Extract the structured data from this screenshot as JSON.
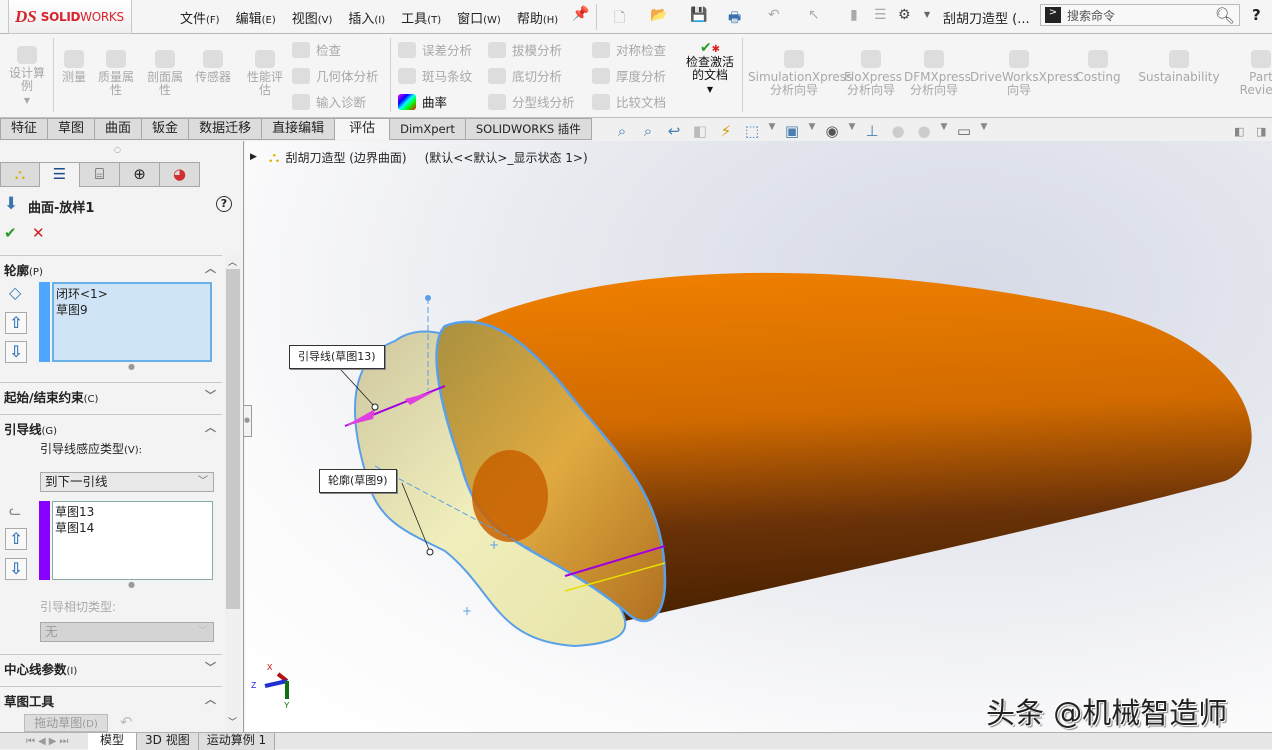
{
  "app": {
    "logo_ds": "DS",
    "logo_solid": "SOLID",
    "logo_works": "WORKS",
    "doc_title": "刮胡刀造型 (..."
  },
  "menu": [
    {
      "label": "文件",
      "key": "(F)"
    },
    {
      "label": "编辑",
      "key": "(E)"
    },
    {
      "label": "视图",
      "key": "(V)"
    },
    {
      "label": "插入",
      "key": "(I)"
    },
    {
      "label": "工具",
      "key": "(T)"
    },
    {
      "label": "窗口",
      "key": "(W)"
    },
    {
      "label": "帮助",
      "key": "(H)"
    }
  ],
  "quick_access": [
    "new-icon",
    "open-icon",
    "save-icon",
    "print-icon",
    "undo-icon",
    "select-icon",
    "rebuild-icon",
    "file-properties-icon",
    "options-icon"
  ],
  "search": {
    "placeholder": "搜索命令",
    "help": "?"
  },
  "ribbon": {
    "design_study": "设计算例",
    "big_buttons": [
      "测量",
      "质量属性",
      "剖面属性",
      "传感器",
      "性能评估"
    ],
    "col1": [
      "检查",
      "几何体分析",
      "输入诊断"
    ],
    "col2": [
      "误差分析",
      "斑马条纹",
      "曲率"
    ],
    "col3": [
      "拔模分析",
      "底切分析",
      "分型线分析"
    ],
    "col4": [
      "对称检查",
      "厚度分析",
      "比较文档"
    ],
    "check_active": "检查激活的文档",
    "addins": [
      {
        "line1": "SimulationXpress",
        "line2": "分析向导"
      },
      {
        "line1": "FloXpress",
        "line2": "分析向导"
      },
      {
        "line1": "DFMXpress",
        "line2": "分析向导"
      },
      {
        "line1": "DriveWorksXpress",
        "line2": "向导"
      },
      {
        "line1": "Costing",
        "line2": ""
      },
      {
        "line1": "Sustainability",
        "line2": ""
      },
      {
        "line1": "Part",
        "line2": "Review"
      }
    ]
  },
  "tabs": [
    {
      "label": "特征",
      "active": false
    },
    {
      "label": "草图",
      "active": false
    },
    {
      "label": "曲面",
      "active": false
    },
    {
      "label": "钣金",
      "active": false
    },
    {
      "label": "数据迁移",
      "active": false
    },
    {
      "label": "直接编辑",
      "active": false
    },
    {
      "label": "评估",
      "active": true
    },
    {
      "label": "DimXpert",
      "active": false
    },
    {
      "label": "SOLIDWORKS 插件",
      "active": false
    }
  ],
  "panel": {
    "feature_title": "曲面-放样1",
    "sections": {
      "profile": {
        "title": "轮廓",
        "key": "(P)",
        "items": [
          "闭环<1>",
          "草图9"
        ],
        "color": "#4da6ff"
      },
      "start_end": {
        "title": "起始/结束约束",
        "key": "(C)"
      },
      "guides": {
        "title": "引导线",
        "key": "(G)",
        "influence_label": "引导线感应类型",
        "influence_key": "(V):",
        "influence_value": "到下一引线",
        "items": [
          "草图13",
          "草图14"
        ],
        "color": "#8800ff",
        "tangency_label": "引导相切类型:",
        "tangency_value": "无"
      },
      "centerline": {
        "title": "中心线参数",
        "key": "(I)"
      },
      "sketch_tools": {
        "title": "草图工具",
        "drag_button": "拖动草图",
        "drag_key": "(D)"
      }
    }
  },
  "viewport": {
    "tree_root": "刮胡刀造型 (边界曲面)",
    "tree_config": "(默认<<默认>_显示状态 1>)",
    "callouts": {
      "guide": "引导线(草图13)",
      "profile": "轮廓(草图9)"
    },
    "triad": {
      "x": "X",
      "y": "Y",
      "z": "Z"
    }
  },
  "bottom_tabs": [
    {
      "label": "模型",
      "active": true
    },
    {
      "label": "3D 视图",
      "active": false
    },
    {
      "label": "运动算例 1",
      "active": false
    }
  ],
  "watermark": "头条 @机械智造师"
}
